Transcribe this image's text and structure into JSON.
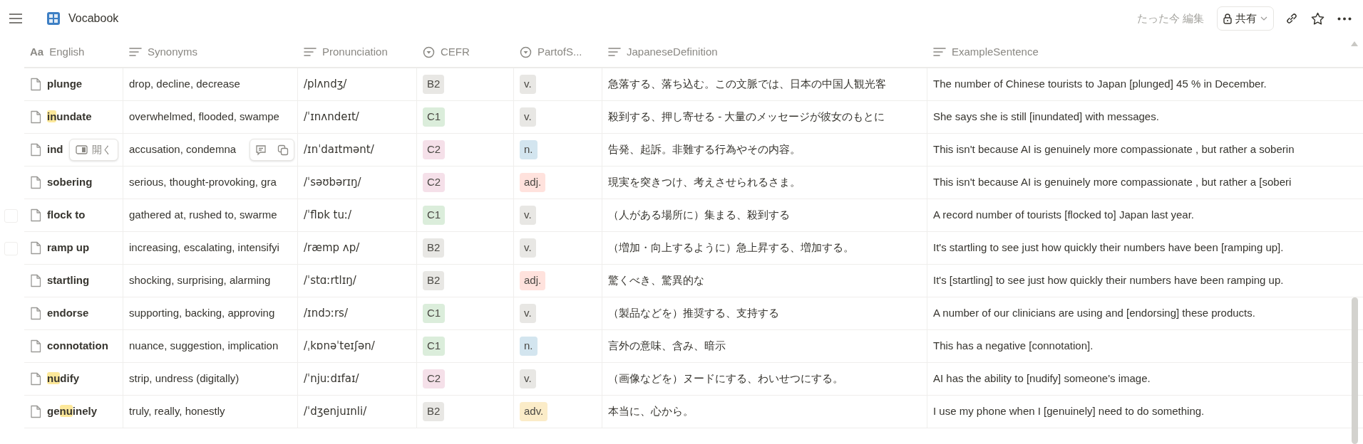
{
  "topbar": {
    "title": "Vocabook",
    "edited": "たった今 編集",
    "share_label": "共有"
  },
  "columns": [
    {
      "kind": "title",
      "icon_text": "Aa",
      "label": "English"
    },
    {
      "kind": "text",
      "label": "Synonyms"
    },
    {
      "kind": "text",
      "label": "Pronunciation"
    },
    {
      "kind": "select",
      "label": "CEFR"
    },
    {
      "kind": "select",
      "label": "PartofS..."
    },
    {
      "kind": "text",
      "label": "JapaneseDefinition"
    },
    {
      "kind": "text",
      "label": "ExampleSentence"
    }
  ],
  "rows": [
    {
      "english": [
        {
          "text": "plunge",
          "highlighted": false
        }
      ],
      "synonyms": "drop, decline, decrease",
      "pronunciation": "/plʌndʒ/",
      "cefr": {
        "label": "B2",
        "color": "#e8e7e4"
      },
      "pos": {
        "label": "v.",
        "color": "#e8e7e4"
      },
      "japanese": "急落する、落ち込む。この文脈では、日本の中国人観光客",
      "example": "The number of Chinese tourists to Japan [plunged] 45 % in December."
    },
    {
      "english": [
        {
          "text": "in",
          "highlighted": true
        },
        {
          "text": "undate",
          "highlighted": false
        }
      ],
      "synonyms": "overwhelmed, flooded, swampe",
      "pronunciation": "/ˈɪnʌndeɪt/",
      "cefr": {
        "label": "C1",
        "color": "#dbeddb"
      },
      "pos": {
        "label": "v.",
        "color": "#e8e7e4"
      },
      "japanese": "殺到する、押し寄せる - 大量のメッセージが彼女のもとに",
      "example": "She says she is still [inundated] with messages."
    },
    {
      "english": [
        {
          "text": "ind",
          "highlighted": false
        }
      ],
      "hover_actions": {
        "open_label": "開く"
      },
      "synonyms": "accusation, condemna",
      "pronunciation": "/ɪnˈdaɪtmənt/",
      "cefr": {
        "label": "C2",
        "color": "#f5e0e9"
      },
      "pos": {
        "label": "n.",
        "color": "#d3e5ef"
      },
      "japanese": "告発、起訴。非難する行為やその内容。",
      "example": "This isn't because AI is genuinely more compassionate , but rather a soberin"
    },
    {
      "english": [
        {
          "text": "sobering",
          "highlighted": false
        }
      ],
      "synonyms": "serious, thought-provoking, gra",
      "pronunciation": "/ˈsəʊbərɪŋ/",
      "cefr": {
        "label": "C2",
        "color": "#f5e0e9"
      },
      "pos": {
        "label": "adj.",
        "color": "#ffe2dd"
      },
      "japanese": "現実を突きつけ、考えさせられるさま。",
      "example": "This isn't because AI is genuinely more compassionate , but rather a [soberi"
    },
    {
      "checkbox": {
        "checked": false
      },
      "english": [
        {
          "text": "flock to",
          "highlighted": false
        }
      ],
      "synonyms": "gathered at, rushed to, swarme",
      "pronunciation": "/ˈflɒk tuː/",
      "cefr": {
        "label": "C1",
        "color": "#dbeddb"
      },
      "pos": {
        "label": "v.",
        "color": "#e8e7e4"
      },
      "japanese": "（人がある場所に）集まる、殺到する",
      "example": "A record number of tourists [flocked to] Japan last year."
    },
    {
      "checkbox": {
        "checked": false
      },
      "english": [
        {
          "text": "ramp up",
          "highlighted": false
        }
      ],
      "synonyms": "increasing, escalating, intensifyi",
      "pronunciation": "/ræmp ʌp/",
      "cefr": {
        "label": "B2",
        "color": "#e8e7e4"
      },
      "pos": {
        "label": "v.",
        "color": "#e8e7e4"
      },
      "japanese": "（増加・向上するように）急上昇する、増加する。",
      "example": "It's startling to see just how quickly their numbers have been [ramping up]."
    },
    {
      "english": [
        {
          "text": "startling",
          "highlighted": false
        }
      ],
      "synonyms": "shocking, surprising, alarming",
      "pronunciation": "/ˈstɑːrtlɪŋ/",
      "cefr": {
        "label": "B2",
        "color": "#e8e7e4"
      },
      "pos": {
        "label": "adj.",
        "color": "#ffe2dd"
      },
      "japanese": "驚くべき、驚異的な",
      "example": "It's [startling] to see just how quickly their numbers have been ramping up."
    },
    {
      "english": [
        {
          "text": "endorse",
          "highlighted": false
        }
      ],
      "synonyms": "supporting, backing, approving",
      "pronunciation": "/ɪndɔːrs/",
      "cefr": {
        "label": "C1",
        "color": "#dbeddb"
      },
      "pos": {
        "label": "v.",
        "color": "#e8e7e4"
      },
      "japanese": "（製品などを）推奨する、支持する",
      "example": "A number of our clinicians are using and [endorsing] these products."
    },
    {
      "english": [
        {
          "text": "connotation",
          "highlighted": false
        }
      ],
      "synonyms": "nuance, suggestion, implication",
      "pronunciation": "/ˌkɒnəˈteɪʃən/",
      "cefr": {
        "label": "C1",
        "color": "#dbeddb"
      },
      "pos": {
        "label": "n.",
        "color": "#d3e5ef"
      },
      "japanese": "言外の意味、含み、暗示",
      "example": "This has a negative [connotation]."
    },
    {
      "english": [
        {
          "text": "nu",
          "highlighted": true
        },
        {
          "text": "dify",
          "highlighted": false
        }
      ],
      "synonyms": "strip, undress (digitally)",
      "pronunciation": "/ˈnjuːdɪfaɪ/",
      "cefr": {
        "label": "C2",
        "color": "#f5e0e9"
      },
      "pos": {
        "label": "v.",
        "color": "#e8e7e4"
      },
      "japanese": "（画像などを）ヌードにする、わいせつにする。",
      "example": "AI has the ability to [nudify] someone's image."
    },
    {
      "english": [
        {
          "text": "ge",
          "highlighted": false
        },
        {
          "text": "nu",
          "highlighted": true
        },
        {
          "text": "inely",
          "highlighted": false
        }
      ],
      "synonyms": "truly, really, honestly",
      "pronunciation": "/ˈdʒenjuɪnli/",
      "cefr": {
        "label": "B2",
        "color": "#e8e7e4"
      },
      "pos": {
        "label": "adv.",
        "color": "#fbecc8"
      },
      "japanese": "本当に、心から。",
      "example": "I use my phone when I [genuinely] need to do something."
    }
  ]
}
